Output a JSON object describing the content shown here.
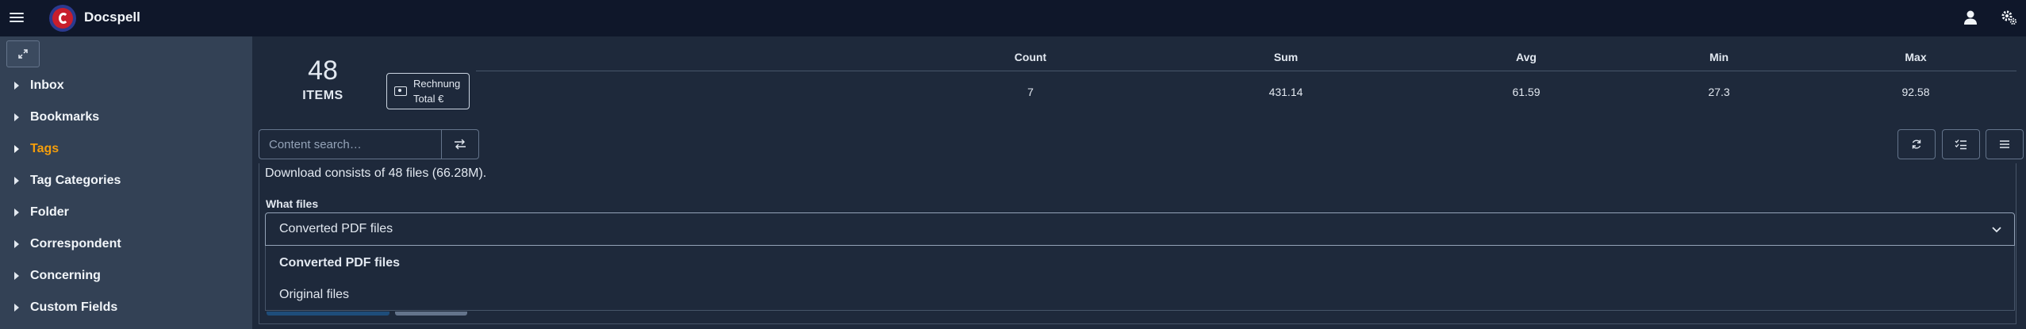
{
  "app": {
    "title": "Docspell"
  },
  "sidebar": {
    "items": [
      {
        "label": "Inbox",
        "active": false
      },
      {
        "label": "Bookmarks",
        "active": false
      },
      {
        "label": "Tags",
        "active": true
      },
      {
        "label": "Tag Categories",
        "active": false
      },
      {
        "label": "Folder",
        "active": false
      },
      {
        "label": "Correspondent",
        "active": false
      },
      {
        "label": "Concerning",
        "active": false
      },
      {
        "label": "Custom Fields",
        "active": false
      }
    ]
  },
  "stats": {
    "count": "48",
    "count_label": "ITEMS",
    "field_chip": {
      "line1": "Rechnung",
      "line2": "Total €"
    },
    "headers": [
      "Count",
      "Sum",
      "Avg",
      "Min",
      "Max"
    ],
    "values": [
      "7",
      "431.14",
      "61.59",
      "27.3",
      "92.58"
    ]
  },
  "search": {
    "placeholder": "Content search…"
  },
  "download": {
    "info": "Download consists of 48 files (66.28M).",
    "what_files_label": "What files",
    "selected": "Converted PDF files",
    "options": [
      "Converted PDF files",
      "Original files"
    ]
  },
  "colors": {
    "active_item": "#f59e0b",
    "topbar": "#0f172a",
    "sidebar": "#334155",
    "main": "#1e293b"
  }
}
